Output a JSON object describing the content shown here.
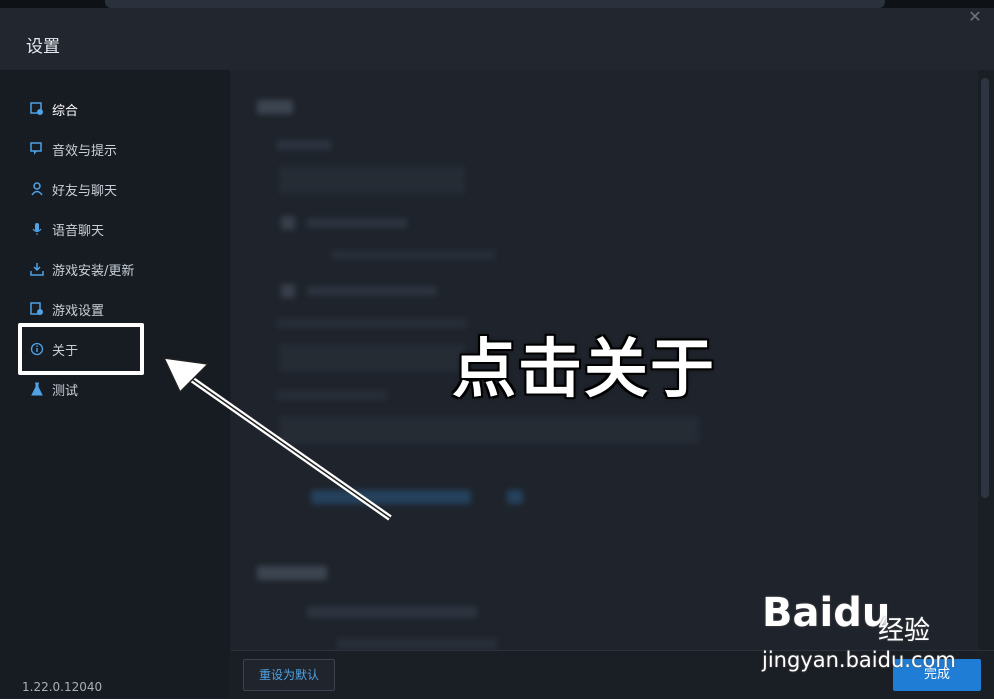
{
  "window": {
    "title": "设置"
  },
  "sidebar": {
    "items": [
      {
        "label": "综合",
        "icon": "gear-icon",
        "active": true
      },
      {
        "label": "音效与提示",
        "icon": "speech-bubble-icon"
      },
      {
        "label": "好友与聊天",
        "icon": "friend-icon"
      },
      {
        "label": "语音聊天",
        "icon": "microphone-icon"
      },
      {
        "label": "游戏安装/更新",
        "icon": "download-icon"
      },
      {
        "label": "游戏设置",
        "icon": "game-settings-icon"
      },
      {
        "label": "关于",
        "icon": "info-icon"
      },
      {
        "label": "测试",
        "icon": "flask-icon"
      }
    ],
    "version": "1.22.0.12040"
  },
  "footer": {
    "reset_label": "重设为默认",
    "done_label": "完成"
  },
  "annotation": {
    "text": "点击关于"
  },
  "watermark": {
    "brand": "Baidu",
    "brand_text": "经验",
    "url": "jingyan.baidu.com"
  },
  "colors": {
    "accent": "#1f7dd6",
    "link": "#4fa3e6",
    "background": "#1c2029"
  }
}
